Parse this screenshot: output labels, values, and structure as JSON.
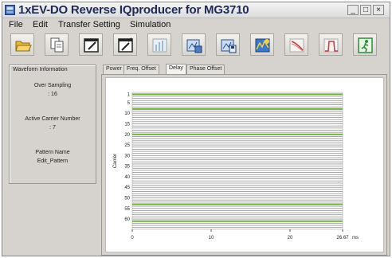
{
  "window": {
    "title": "1xEV-DO Reverse IQproducer for MG3710",
    "controls": {
      "minimize": "_",
      "maximize": "□",
      "close": "×"
    }
  },
  "menu": {
    "items": [
      "File",
      "Edit",
      "Transfer Setting",
      "Simulation"
    ]
  },
  "toolbar": {
    "buttons": [
      {
        "name": "open-folder-icon"
      },
      {
        "name": "copy-document-icon"
      },
      {
        "name": "edit-pattern-icon"
      },
      {
        "name": "edit-parameter-icon"
      },
      {
        "name": "graph-icon"
      },
      {
        "name": "load-pattern-icon"
      },
      {
        "name": "save-pattern-icon"
      },
      {
        "name": "waveform-calc-icon"
      },
      {
        "name": "ccdf-icon"
      },
      {
        "name": "spectrum-icon"
      },
      {
        "name": "exit-icon"
      }
    ]
  },
  "waveform_info": {
    "title": "Waveform Information",
    "over_sampling_label": "Over Sampling",
    "over_sampling_value": ": 16",
    "active_carrier_label": "Active Carrier Number",
    "active_carrier_value": ": 7",
    "pattern_name_label": "Pattern Name",
    "pattern_name_value": "Edit_Pattern"
  },
  "tabs": [
    "Power",
    "Freq. Offset",
    "Delay",
    "Phase Offset"
  ],
  "active_tab": "Delay",
  "colors": {
    "active_carrier": "#6fae3a",
    "inactive_carrier": "#999999",
    "title_text": "#1e2a55"
  },
  "chart_data": {
    "type": "bar",
    "orientation": "horizontal",
    "ylabel": "Carrier",
    "xunit": "ms",
    "xlim": [
      0,
      26.67
    ],
    "xticks": [
      "0",
      "10",
      "20",
      "26.67"
    ],
    "yticks": [
      "1",
      "5",
      "10",
      "15",
      "20",
      "25",
      "30",
      "35",
      "40",
      "45",
      "50",
      "55",
      "60"
    ],
    "carrier_count": 64,
    "active_carriers": [
      1,
      8,
      20,
      53,
      61
    ],
    "bar_value": 26.67
  }
}
